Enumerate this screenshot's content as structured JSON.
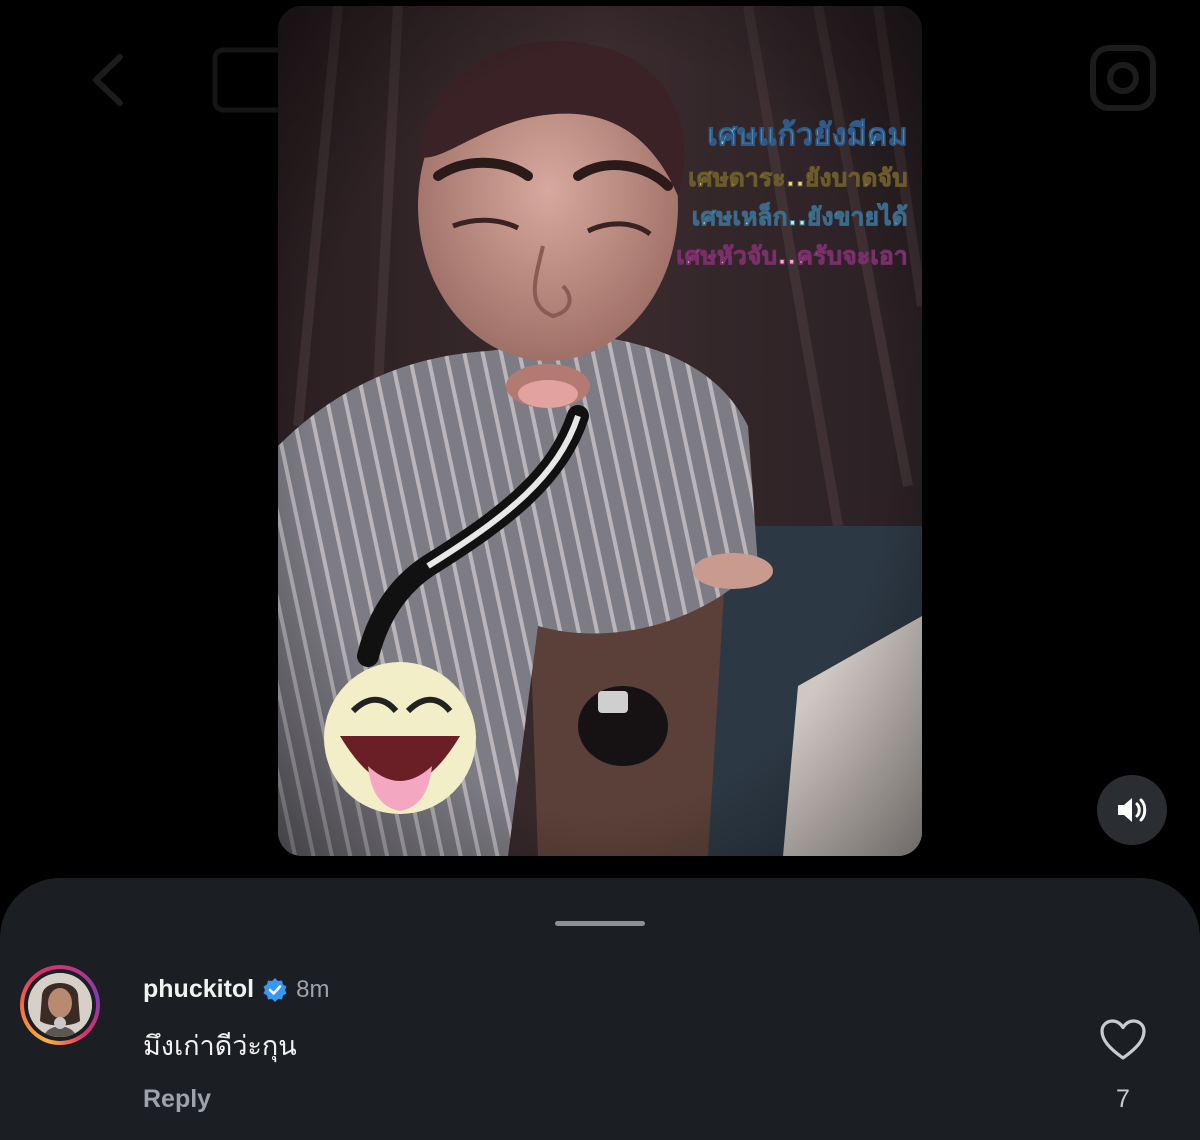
{
  "header": {
    "back_icon": "chevron-left-icon",
    "camera_icon": "camera-icon"
  },
  "story": {
    "captions": [
      "เศษแก้วยังมีคม",
      "เศษดาระ..ยังบาดจับ",
      "เศษเหล็ก..ยังขายได้",
      "เศษหัวจับ..ครับจะเอา"
    ],
    "sticker": "laughing-face-sticker",
    "sound_icon": "speaker-icon"
  },
  "comment": {
    "username": "phuckitol",
    "verified": true,
    "time": "8m",
    "text": "มึงเก่าดีว่ะกุน",
    "reply_label": "Reply",
    "like_count": "7"
  },
  "colors": {
    "background": "#000000",
    "sheet": "#1b1e22",
    "verified_blue": "#3897f0",
    "muted_text": "#9ea3a9"
  }
}
